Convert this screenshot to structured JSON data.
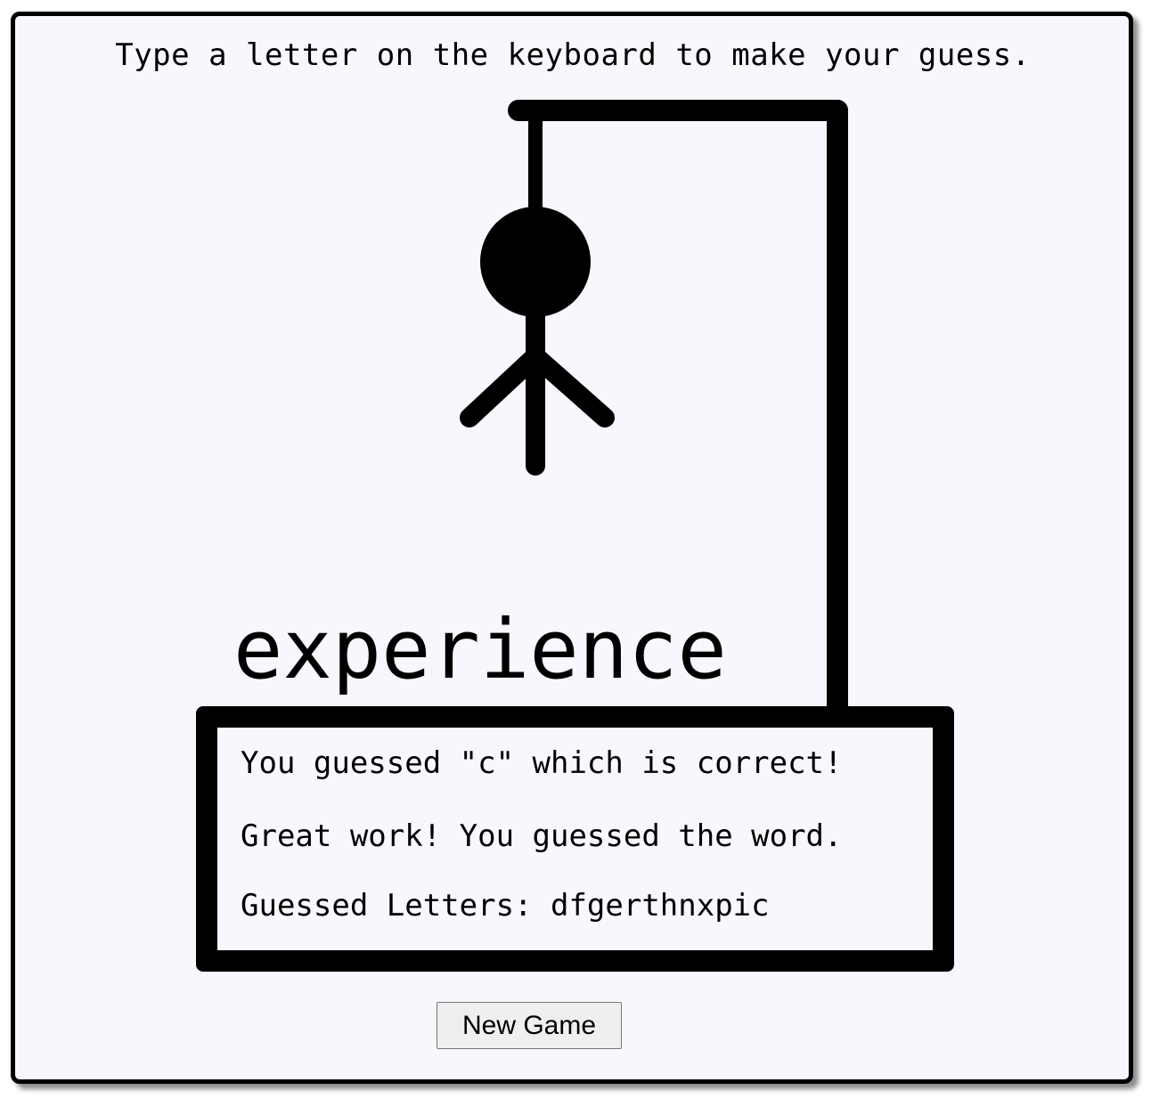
{
  "instruction": "Type a letter on the keyboard to make your guess.",
  "word": "experience",
  "messages": {
    "guess_result": "You guessed \"c\" which is correct!",
    "game_status": "Great work! You guessed the word.",
    "guessed_letters": "Guessed Letters: dfgerthnxpic"
  },
  "new_game_label": "New Game",
  "colors": {
    "background": "#f7f8fd",
    "ink": "#000000",
    "button": "#efefef"
  }
}
